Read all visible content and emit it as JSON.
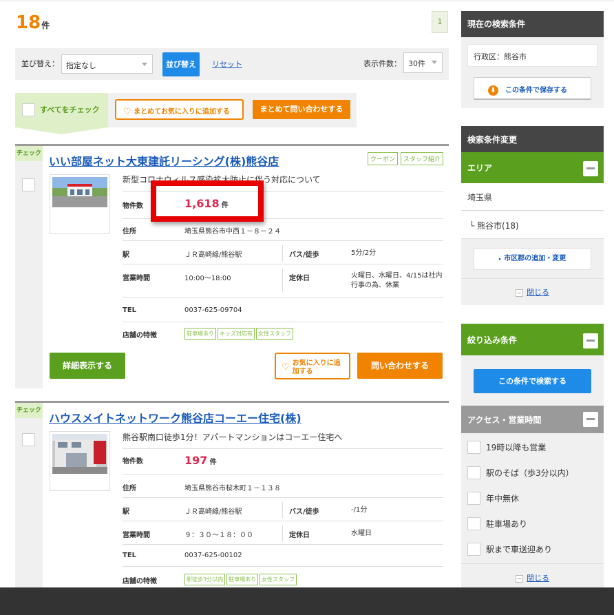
{
  "result": {
    "count": "18",
    "unit": "件",
    "page": "1"
  },
  "sort": {
    "label": "並び替え：",
    "selected": "指定なし",
    "sort_button": "並び替え",
    "reset": "リセット",
    "per_page_label": "表示件数：",
    "per_page": "30件"
  },
  "bulk": {
    "check_all": "すべてをチェック",
    "add_favorites": "まとめてお気に入りに追加する",
    "inquire": "まとめて問い合わせする"
  },
  "check_tag": "チェック",
  "listings": [
    {
      "title": "いい部屋ネット大東建託リーシング(株)熊谷店",
      "badges": [
        "クーポン",
        "スタッフ紹介"
      ],
      "description": "新型コロナウィルス感染拡大防止に伴う対応について",
      "property_count_label": "物件数",
      "property_count": "1,618",
      "property_count_unit": "件",
      "address_label": "住所",
      "address": "埼玉県熊谷市中西１－８－２４",
      "station_label": "駅",
      "station": "ＪＲ高崎線/熊谷駅",
      "bus_label": "バス/徒歩",
      "bus": "5分/2分",
      "hours_label": "営業時間",
      "hours": "10:00～18:00",
      "holiday_label": "定休日",
      "holiday": "火曜日、水曜日、4/15は社内行事の為、休業",
      "tel_label": "TEL",
      "tel": "0037-625-09704",
      "features_label": "店舗の特徴",
      "features": [
        "駐車場あり",
        "キッズ対応有",
        "女性スタッフ"
      ],
      "detail_button": "詳細表示する",
      "fav_button": "お気に入りに追加する",
      "inquire_button": "問い合わせする"
    },
    {
      "title": "ハウスメイトネットワーク熊谷店コーエー住宅(株)",
      "description": "熊谷駅南口徒歩1分！アパートマンションはコーエー住宅へ",
      "property_count_label": "物件数",
      "property_count": "197",
      "property_count_unit": "件",
      "address_label": "住所",
      "address": "埼玉県熊谷市桜木町１－１３８",
      "station_label": "駅",
      "station": "ＪＲ高崎線/熊谷駅",
      "bus_label": "バス/徒歩",
      "bus": "-/1分",
      "hours_label": "営業時間",
      "hours": "９：３０～１８：００",
      "holiday_label": "定休日",
      "holiday": "水曜日",
      "tel_label": "TEL",
      "tel": "0037-625-00102",
      "features_label": "店舗の特徴",
      "features": [
        "駅徒歩3分以内",
        "駐車場あり",
        "女性スタッフ"
      ]
    }
  ],
  "sidebar": {
    "current_title": "現在の検索条件",
    "current_condition": "行政区：熊谷市",
    "save_button": "この条件で保存する",
    "change_title": "検索条件変更",
    "area_title": "エリア",
    "prefecture": "埼玉県",
    "city": "└ 熊谷市(18)",
    "add_city_button": "市区郡の追加・変更",
    "close": "閉じる",
    "filter_title": "絞り込み条件",
    "search_button": "この条件で検索する",
    "access_title": "アクセス・営業時間",
    "options": [
      "19時以降も営業",
      "駅のそば（歩3分以内）",
      "年中無休",
      "駐車場あり",
      "駅まで車送迎あり"
    ],
    "close2": "閉じる"
  },
  "colors": {
    "accent_orange": "#f08300",
    "green": "#5aa01e",
    "blue": "#1f8be8",
    "link": "#1a5ab9",
    "red_number": "#e0284f",
    "highlight": "#e60000"
  }
}
